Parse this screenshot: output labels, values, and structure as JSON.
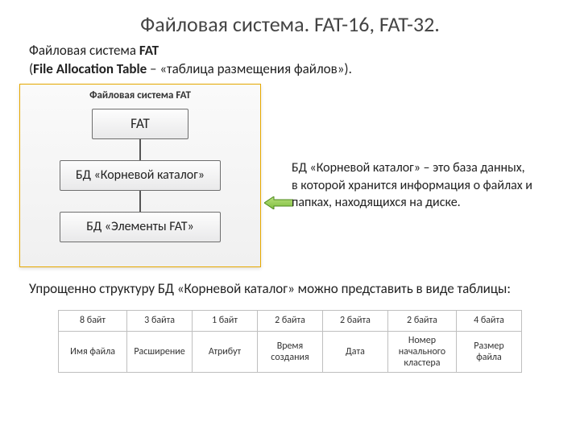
{
  "title": "Файловая система. FAT-16, FAT-32.",
  "intro": {
    "line1_a": "Файловая система ",
    "line1_b": "FAT",
    "paren_open": "(",
    "bold": "File Allocation Table",
    "rest": " – «таблица размещения файлов»)."
  },
  "diagram": {
    "caption": "Файловая система FAT",
    "box1": "FAT",
    "box2": "БД «Корневой каталог»",
    "box3": "БД «Элементы FAT»"
  },
  "callout": "БД «Корневой каталог» – это база данных, в которой хранится информация о файлах и папках, находящихся на диске.",
  "summary": "Упрощенно структуру БД «Корневой каталог» можно представить в виде таблицы:",
  "table": {
    "row1": [
      "8 байт",
      "3 байта",
      "1 байт",
      "2 байта",
      "2 байта",
      "2 байта",
      "4 байта"
    ],
    "row2": [
      "Имя файла",
      "Расширение",
      "Атрибут",
      "Время создания",
      "Дата",
      "Номер начального кластера",
      "Размер файла"
    ]
  }
}
